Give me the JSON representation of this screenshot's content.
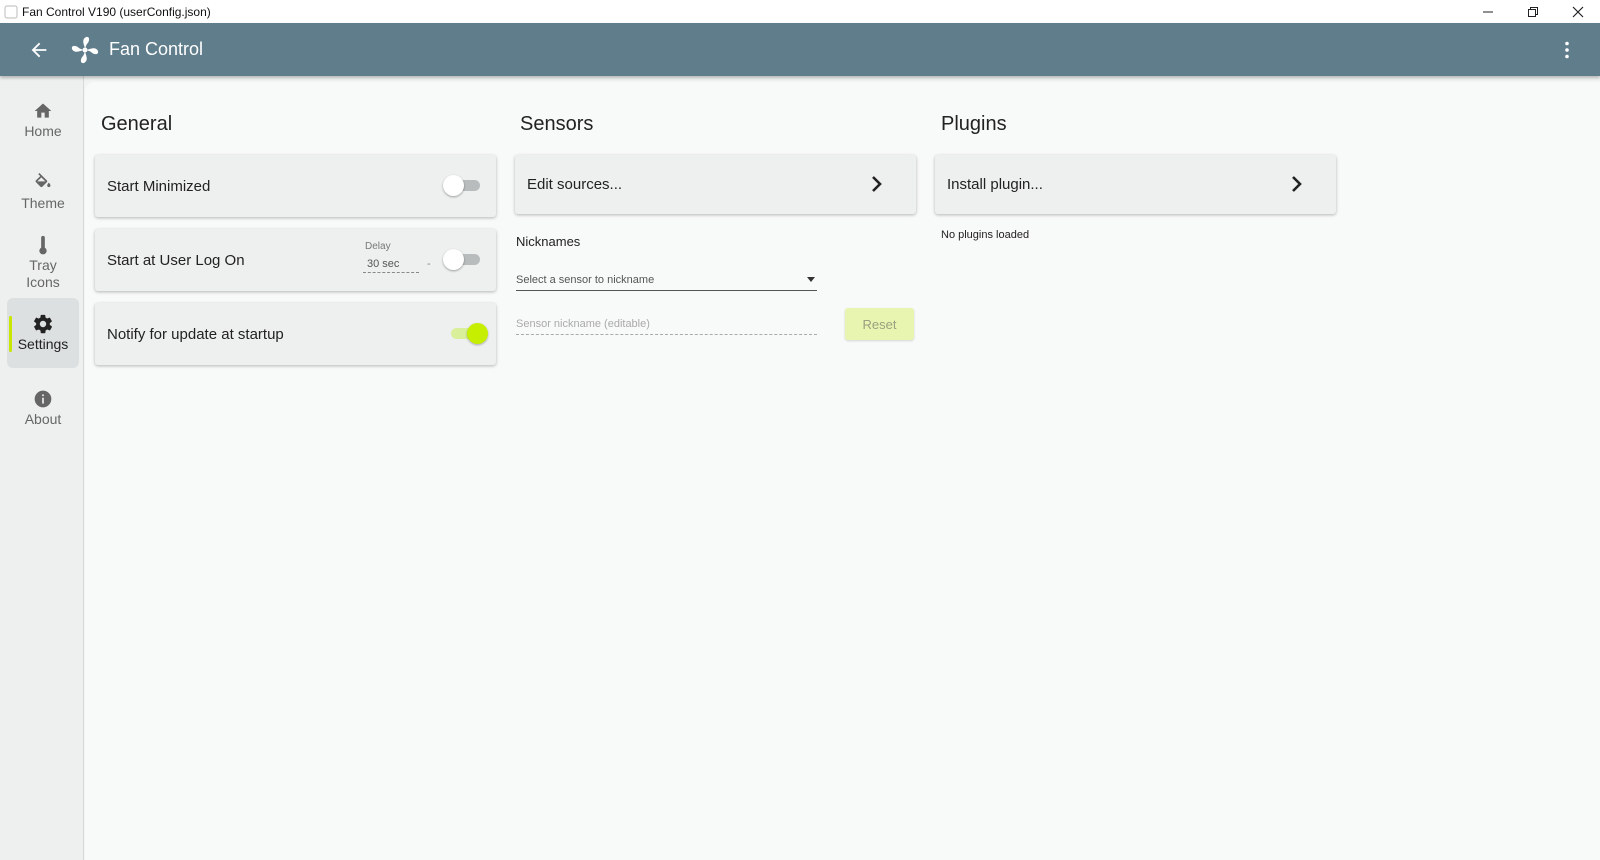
{
  "window": {
    "title": "Fan Control V190 (userConfig.json)",
    "controls": [
      "minimize-icon",
      "restore-icon",
      "close-icon"
    ]
  },
  "appbar": {
    "title": "Fan Control",
    "back_icon": "arrow-left-icon",
    "logo_icon": "fan-icon",
    "menu_icon": "more-vertical-icon",
    "color": "#607d8b"
  },
  "sidebar": {
    "items": [
      {
        "label": "Home",
        "icon": "home-icon",
        "active": false
      },
      {
        "label": "Theme",
        "icon": "paint-bucket-icon",
        "active": false
      },
      {
        "label": "Tray Icons",
        "icon": "thermometer-icon",
        "active": false
      },
      {
        "label": "Settings",
        "icon": "gear-icon",
        "active": true
      },
      {
        "label": "About",
        "icon": "info-icon",
        "active": false
      }
    ]
  },
  "general": {
    "title": "General",
    "start_minimized": {
      "label": "Start Minimized",
      "enabled": false
    },
    "start_at_logon": {
      "label": "Start at User Log On",
      "enabled": false,
      "delay_caption": "Delay",
      "delay_value": "30 sec",
      "delay_dash": "-"
    },
    "notify_update": {
      "label": "Notify for update at startup",
      "enabled": true
    }
  },
  "sensors": {
    "title": "Sensors",
    "edit_sources_label": "Edit sources...",
    "nicknames_label": "Nicknames",
    "select_placeholder": "Select a sensor to nickname",
    "nickname_placeholder": "Sensor nickname (editable)",
    "reset_label": "Reset"
  },
  "plugins": {
    "title": "Plugins",
    "install_label": "Install plugin...",
    "status": "No plugins loaded"
  },
  "colors": {
    "accent": "#c6ef00",
    "appbar": "#607d8b"
  }
}
